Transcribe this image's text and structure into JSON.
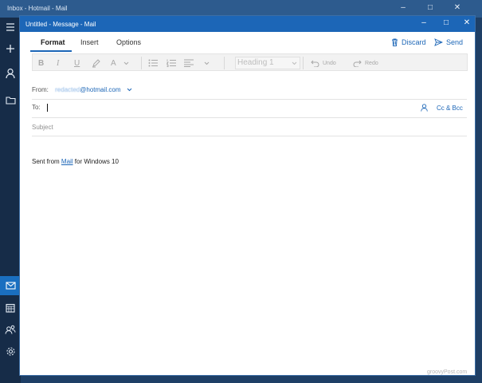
{
  "background_window": {
    "title": "Inbox - Hotmail - Mail",
    "controls": {
      "minimize": "–",
      "maximize": "□",
      "close": "✕"
    }
  },
  "sidebar": {
    "items": [
      {
        "icon": "hamburger-menu-icon",
        "glyph": "≡"
      },
      {
        "icon": "new-mail-icon",
        "glyph": "+"
      },
      {
        "icon": "account-icon",
        "glyph": "person"
      },
      {
        "icon": "folder-icon",
        "glyph": "folder"
      },
      {
        "icon": "mail-icon",
        "glyph": "mail"
      },
      {
        "icon": "calendar-icon",
        "glyph": "calendar"
      },
      {
        "icon": "people-icon",
        "glyph": "people"
      },
      {
        "icon": "settings-icon",
        "glyph": "gear"
      }
    ]
  },
  "compose": {
    "title": "Untitled - Message - Mail",
    "controls": {
      "minimize": "–",
      "maximize": "□",
      "close": "✕"
    },
    "tabs": [
      {
        "label": "Format",
        "active": true
      },
      {
        "label": "Insert",
        "active": false
      },
      {
        "label": "Options",
        "active": false
      }
    ],
    "actions": {
      "discard": "Discard",
      "send": "Send"
    },
    "toolbar": {
      "bold": "B",
      "italic": "I",
      "underline": "U",
      "font_color": "A",
      "style_value": "Heading 1",
      "undo": "Undo",
      "redo": "Redo"
    },
    "from": {
      "label": "From:",
      "address_hidden": "redacted",
      "domain": "@hotmail.com"
    },
    "to": {
      "label": "To:",
      "value": ""
    },
    "cc_bcc": "Cc & Bcc",
    "subject": {
      "placeholder": "Subject"
    },
    "body": {
      "prefix": "Sent from ",
      "link": "Mail",
      "suffix": " for Windows 10"
    }
  },
  "watermark": "groovyPost.com",
  "colors": {
    "accent": "#1c66b7",
    "title_bar": "#1c66b7",
    "sidebar_active": "#1a6fc0"
  }
}
